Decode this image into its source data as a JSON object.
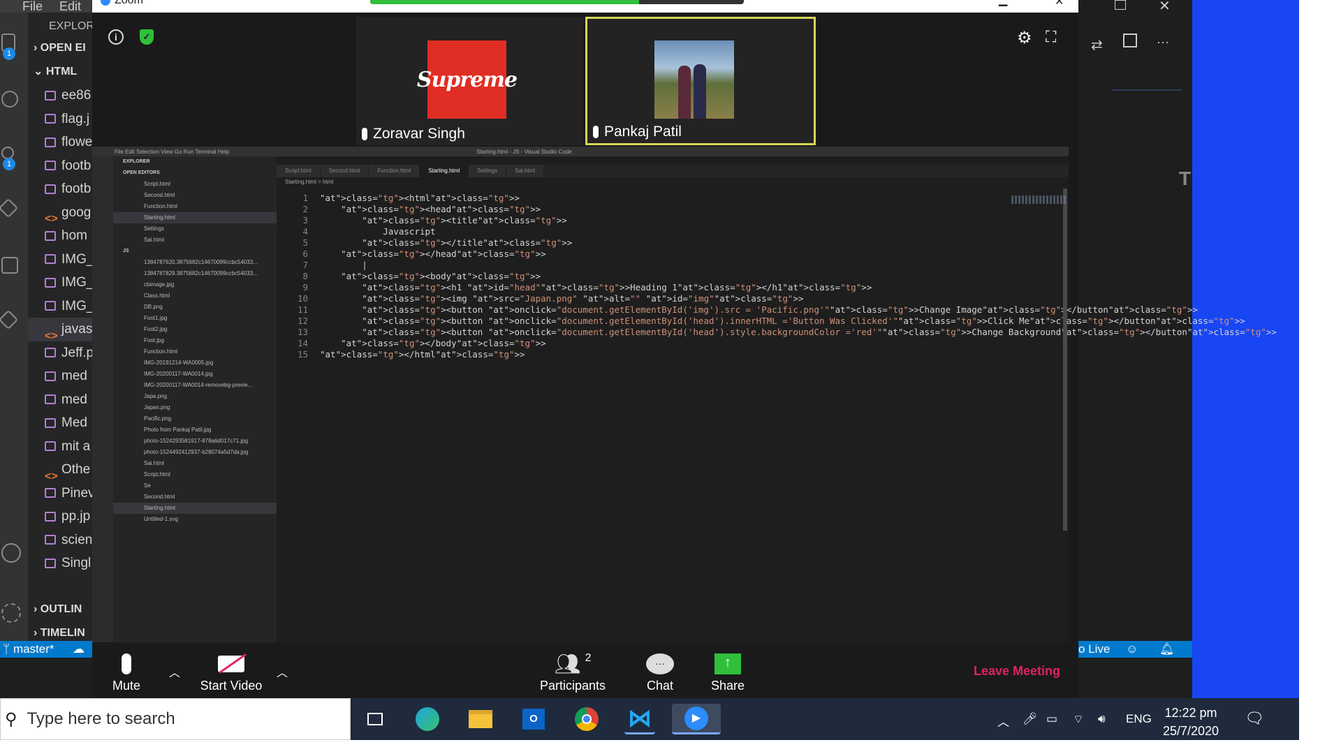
{
  "vscode": {
    "menu": [
      "File",
      "Edit"
    ],
    "explorer_title": "EXPLORE",
    "sections": {
      "open_editors": "OPEN EI",
      "html": "HTML",
      "outline": "OUTLIN",
      "timeline": "TIMELIN"
    },
    "files": [
      {
        "name": "ee86",
        "type": "image"
      },
      {
        "name": "flag.j",
        "type": "image"
      },
      {
        "name": "flowe",
        "type": "image"
      },
      {
        "name": "footb",
        "type": "image"
      },
      {
        "name": "footb",
        "type": "image"
      },
      {
        "name": "goog",
        "type": "code"
      },
      {
        "name": "hom",
        "type": "image"
      },
      {
        "name": "IMG_",
        "type": "image"
      },
      {
        "name": "IMG_",
        "type": "image"
      },
      {
        "name": "IMG_",
        "type": "image"
      },
      {
        "name": "javas",
        "type": "code"
      },
      {
        "name": "Jeff.p",
        "type": "image"
      },
      {
        "name": "med",
        "type": "image"
      },
      {
        "name": "med",
        "type": "image"
      },
      {
        "name": "Med",
        "type": "image"
      },
      {
        "name": "mit a",
        "type": "image"
      },
      {
        "name": "Othe",
        "type": "code"
      },
      {
        "name": "Pinev",
        "type": "image"
      },
      {
        "name": "pp.jp",
        "type": "image"
      },
      {
        "name": "scien",
        "type": "image"
      },
      {
        "name": "Singl",
        "type": "image"
      }
    ],
    "badges": [
      "1",
      "1"
    ],
    "status": {
      "branch": "master*",
      "live": "o Live"
    }
  },
  "zoom": {
    "title": "Zoom",
    "participants": [
      {
        "name": "Zoravar Singh",
        "avatar_text": "Supreme"
      },
      {
        "name": "Pankaj Patil",
        "avatar_text": ""
      }
    ],
    "controls": {
      "mute": "Mute",
      "start_video": "Start Video",
      "participants": "Participants",
      "participants_count": "2",
      "chat": "Chat",
      "share": "Share",
      "leave": "Leave Meeting"
    }
  },
  "shared_screen": {
    "title": "Starting.html - JS - Visual Studio Code",
    "menu": "File  Edit  Selection  View  Go  Run  Terminal  Help",
    "tabs": [
      "Script.html",
      "Second.html",
      "Function.html",
      "Starting.html",
      "Settings",
      "Sai.html"
    ],
    "active_tab": "Starting.html",
    "breadcrumb": "Starting.html > html",
    "explorer_header": "EXPLORER",
    "open_editors_header": "OPEN EDITORS",
    "open_editors": [
      "Script.html",
      "Second.html",
      "Function.html",
      "Starting.html",
      "Settings",
      "Sai.html"
    ],
    "folder_header": "JS",
    "folder_files": [
      "1384787620.3875682c14670099ccbc54033...",
      "1384787829.3875682c14670099ccbc54033...",
      "cbimage.jpg",
      "Class.html",
      "DB.png",
      "Foot1.jpg",
      "Foot2.jpg",
      "Foot.jpg",
      "Function.html",
      "IMG-20191214-WA0005.jpg",
      "IMG-20200117-WA0014.jpg",
      "IMG-20200117-WA0014-removebg-previe...",
      "Japa.png",
      "Japan.png",
      "Pacific.png",
      "Photo from Pankaj Patil.jpg",
      "photo-1524293581917-878a6d017c71.jpg",
      "photo-1524492412937-b28074a5d7da.jpg",
      "Sai.html",
      "Script.html",
      "Se",
      "Second.html",
      "Starting.html",
      "Untitled-1.svg"
    ],
    "code_lines": [
      "<html>",
      "    <head>",
      "        <title>",
      "            Javascript",
      "        </title>",
      "    </head>",
      "        |",
      "    <body>",
      "        <h1 id=\"head\">Heading 1</h1>",
      "        <img src=\"Japan.png\" alt=\"\" id=\"img\">",
      "        <button onclick=\"document.getElementById('img').src = 'Pacific.png'\">Change Image</button>",
      "        <button onclick=\"document.getElementById('head').innerHTML ='Button Was Clicked'\">Click Me</button>",
      "        <button onclick=\"document.getElementById('head').style.backgroundColor ='red'\">Change Background</button>",
      "    </body>",
      "</html>"
    ]
  },
  "taskbar": {
    "search_placeholder": "Type here to search",
    "language": "ENG",
    "time": "12:22 pm",
    "date": "25/7/2020"
  },
  "colors": {
    "leave": "#e0245e",
    "active_speaker": "#d6d65a",
    "taskbar": "#1f2a3c",
    "statusbar": "#007acc",
    "share_green": "#2fbf3a"
  }
}
